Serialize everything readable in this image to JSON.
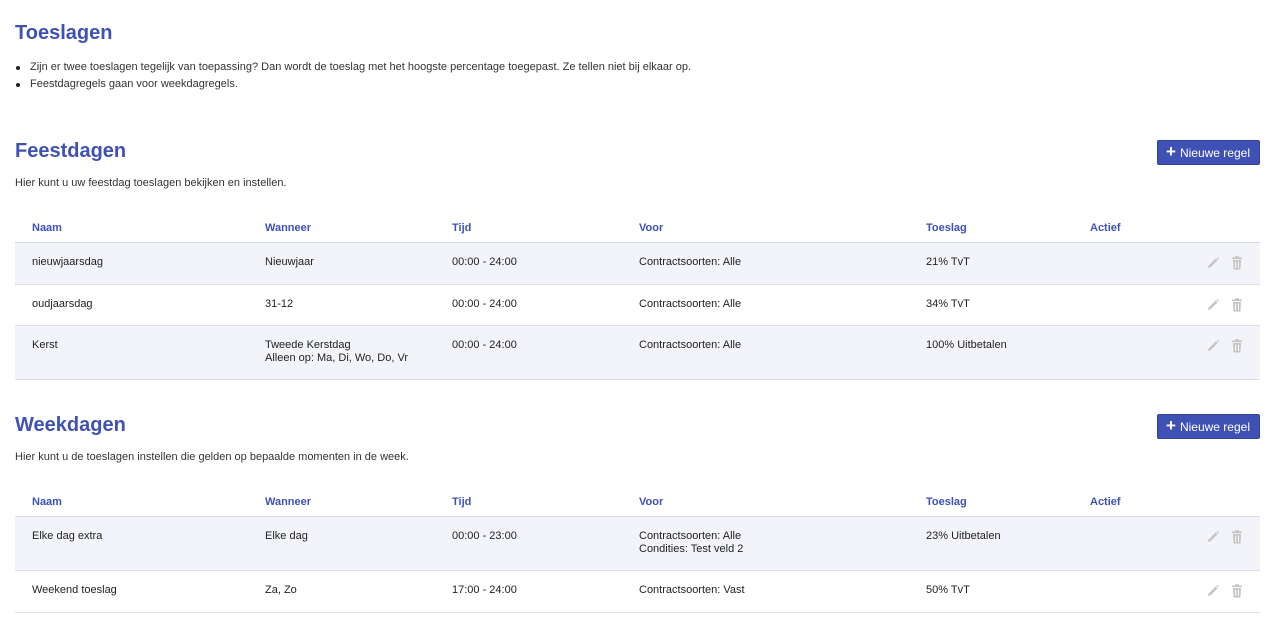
{
  "page": {
    "title": "Toeslagen",
    "rules": [
      "Zijn er twee toeslagen tegelijk van toepassing? Dan wordt de toeslag met het hoogste percentage toegepast. Ze tellen niet bij elkaar op.",
      "Feestdagregels gaan voor weekdagregels."
    ]
  },
  "feestdagen": {
    "title": "Feestdagen",
    "description": "Hier kunt u uw feestdag toeslagen bekijken en instellen.",
    "new_button": "Nieuwe regel",
    "columns": {
      "naam": "Naam",
      "wanneer": "Wanneer",
      "tijd": "Tijd",
      "voor": "Voor",
      "toeslag": "Toeslag",
      "actief": "Actief"
    },
    "rows": [
      {
        "naam": "nieuwjaarsdag",
        "wanneer": "Nieuwjaar",
        "wanneer_2": "",
        "tijd": "00:00 - 24:00",
        "voor": "Contractsoorten: Alle",
        "voor_2": "",
        "toeslag": "21% TvT",
        "actief": true
      },
      {
        "naam": "oudjaarsdag",
        "wanneer": "31-12",
        "wanneer_2": "",
        "tijd": "00:00 - 24:00",
        "voor": "Contractsoorten: Alle",
        "voor_2": "",
        "toeslag": "34% TvT",
        "actief": true
      },
      {
        "naam": "Kerst",
        "wanneer": "Tweede Kerstdag",
        "wanneer_2": "Alleen op: Ma, Di, Wo, Do, Vr",
        "tijd": "00:00 - 24:00",
        "voor": "Contractsoorten: Alle",
        "voor_2": "",
        "toeslag": "100% Uitbetalen",
        "actief": true
      }
    ]
  },
  "weekdagen": {
    "title": "Weekdagen",
    "description": "Hier kunt u de toeslagen instellen die gelden op bepaalde momenten in de week.",
    "new_button": "Nieuwe regel",
    "columns": {
      "naam": "Naam",
      "wanneer": "Wanneer",
      "tijd": "Tijd",
      "voor": "Voor",
      "toeslag": "Toeslag",
      "actief": "Actief"
    },
    "rows": [
      {
        "naam": "Elke dag extra",
        "wanneer": "Elke dag",
        "wanneer_2": "",
        "tijd": "00:00 - 23:00",
        "voor": "Contractsoorten: Alle",
        "voor_2": "Condities: Test veld 2",
        "toeslag": "23% Uitbetalen",
        "actief": true
      },
      {
        "naam": "Weekend toeslag",
        "wanneer": "Za, Zo",
        "wanneer_2": "",
        "tijd": "17:00 - 24:00",
        "voor": "Contractsoorten: Vast",
        "voor_2": "",
        "toeslag": "50% TvT",
        "actief": true
      }
    ]
  },
  "colors": {
    "accent": "#3f51b5",
    "active": "#1ec41e",
    "icon": "#c4c4c4",
    "row_alt": "#f3f4f9"
  },
  "icons": {
    "add": "plus-icon",
    "edit": "pencil-icon",
    "delete": "trash-icon",
    "status": "status-dot-icon"
  }
}
